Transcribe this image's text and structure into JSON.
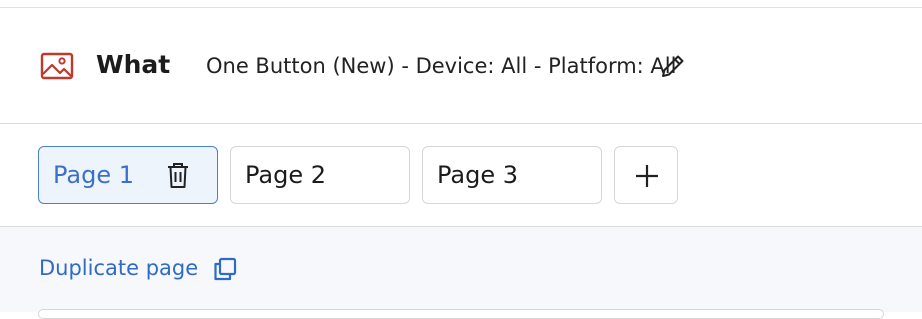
{
  "header": {
    "icon": "image-icon",
    "title": "What",
    "description": "One Button (New) - Device: All - Platform: All",
    "edit_icon": "pencil-icon",
    "icon_color": "#c0392b"
  },
  "tabs": [
    {
      "label": "Page 1",
      "active": true,
      "icon": "trash-icon"
    },
    {
      "label": "Page 2",
      "active": false
    },
    {
      "label": "Page 3",
      "active": false
    }
  ],
  "add_tab": {
    "icon": "plus-icon"
  },
  "panel": {
    "duplicate_label": "Duplicate page",
    "duplicate_icon": "copy-icon"
  },
  "colors": {
    "accent": "#3c70c8",
    "active_tab_bg": "#eef4fc",
    "panel_bg": "#f6f8fb"
  }
}
